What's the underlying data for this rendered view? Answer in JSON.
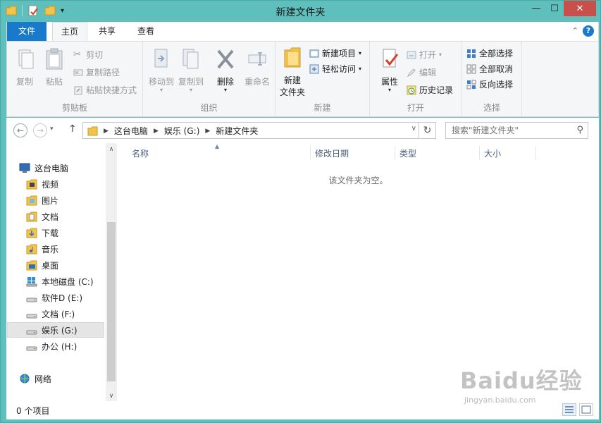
{
  "window": {
    "title": "新建文件夹",
    "controls": {
      "minimize": "—",
      "maximize": "☐",
      "close": "✕"
    }
  },
  "ribbon_tabs": {
    "file": "文件",
    "home": "主页",
    "share": "共享",
    "view": "查看",
    "help": "?"
  },
  "ribbon": {
    "clipboard": {
      "label": "剪贴板",
      "copy": "复制",
      "paste": "粘贴",
      "cut": "剪切",
      "copy_path": "复制路径",
      "paste_shortcut": "粘贴快捷方式"
    },
    "organize": {
      "label": "组织",
      "move_to": "移动到",
      "copy_to": "复制到",
      "delete": "删除",
      "rename": "重命名"
    },
    "new": {
      "label": "新建",
      "new_folder_line1": "新建",
      "new_folder_line2": "文件夹",
      "new_item": "新建项目",
      "easy_access": "轻松访问"
    },
    "open": {
      "label": "打开",
      "properties": "属性",
      "open": "打开",
      "edit": "编辑",
      "history": "历史记录"
    },
    "select": {
      "label": "选择",
      "select_all": "全部选择",
      "select_none": "全部取消",
      "invert": "反向选择"
    }
  },
  "address": {
    "crumbs": [
      "这台电脑",
      "娱乐 (G:)",
      "新建文件夹"
    ],
    "search_placeholder": "搜索\"新建文件夹\""
  },
  "nav": {
    "this_pc": "这台电脑",
    "items": [
      "视频",
      "图片",
      "文档",
      "下载",
      "音乐",
      "桌面",
      "本地磁盘 (C:)",
      "软件D (E:)",
      "文档 (F:)",
      "娱乐 (G:)",
      "办公 (H:)"
    ],
    "network": "网络"
  },
  "columns": {
    "name": "名称",
    "modified": "修改日期",
    "type": "类型",
    "size": "大小"
  },
  "empty_message": "该文件夹为空。",
  "status": {
    "item_count": "0 个项目"
  },
  "watermark": {
    "logo": "Baidu经验",
    "url": "jingyan.baidu.com"
  },
  "colors": {
    "titlebar": "#5fbfbd",
    "file_tab": "#1979ca",
    "close": "#c7504b"
  }
}
